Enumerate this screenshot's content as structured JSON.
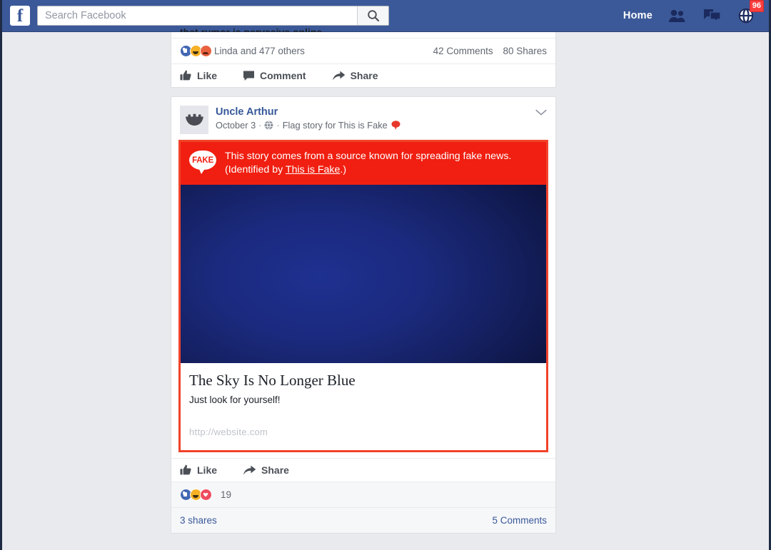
{
  "header": {
    "logo_letter": "f",
    "search": {
      "placeholder": "Search Facebook",
      "value": "",
      "button_icon": "search-icon"
    },
    "home_label": "Home",
    "icons": [
      {
        "name": "friend-requests-icon"
      },
      {
        "name": "messages-icon"
      },
      {
        "name": "notifications-globe-icon",
        "badge": "96"
      }
    ],
    "brand_color": "#3b5998",
    "badge_color": "#fa3e3e"
  },
  "feed": {
    "post_top": {
      "cut_text": "that rumor is pervasive online",
      "reactions": {
        "types": [
          "like",
          "haha",
          "angry"
        ],
        "label": "Linda and 477 others",
        "comments": "42 Comments",
        "shares": "80 Shares"
      },
      "actions": [
        {
          "icon": "thumbs-up-icon",
          "label": "Like"
        },
        {
          "icon": "comment-bubble-icon",
          "label": "Comment"
        },
        {
          "icon": "share-arrow-icon",
          "label": "Share"
        }
      ]
    },
    "post_fake": {
      "author": "Uncle Arthur",
      "avatar_icon": "crown-avatar-icon",
      "date": "October 3",
      "privacy_icon": "globe-icon",
      "meta_separator": "·",
      "flag_text": "Flag story for This is Fake",
      "flag_icon": "fake-flag-icon",
      "menu_icon": "chevron-down-icon",
      "warning": {
        "badge_label": "FAKE",
        "line1": "This story comes from a source known for spreading fake news.",
        "line2_prefix": "(Identified by ",
        "link_label": "This is Fake",
        "line2_suffix": ".)",
        "banner_color": "#f01f11"
      },
      "link_card": {
        "image_alt": "dark-blue-sky-photo",
        "title": "The Sky Is No Longer Blue",
        "description": "Just look for yourself!",
        "url": "http://website.com"
      },
      "actions": [
        {
          "icon": "thumbs-up-icon",
          "label": "Like"
        },
        {
          "icon": "share-arrow-icon",
          "label": "Share"
        }
      ],
      "reactions": {
        "types": [
          "like",
          "haha",
          "love"
        ],
        "count": "19"
      },
      "footer": {
        "shares": "3 shares",
        "comments": "5 Comments"
      }
    }
  }
}
